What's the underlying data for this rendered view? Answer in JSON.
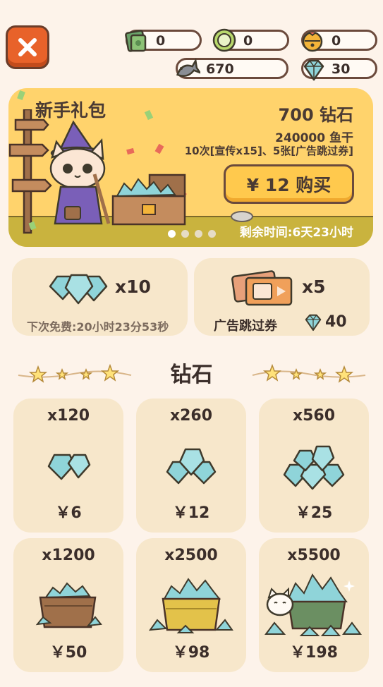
{
  "header": {
    "resources": [
      {
        "name": "cash",
        "value": "0"
      },
      {
        "name": "coin",
        "value": "0"
      },
      {
        "name": "bell",
        "value": "0"
      },
      {
        "name": "fish",
        "value": "670"
      },
      {
        "name": "diamond",
        "value": "30"
      }
    ]
  },
  "banner": {
    "title": "新手礼包",
    "diamond_amount": "700 钻石",
    "fish_amount": "240000 鱼干",
    "bonus": "10次[宣传x15]、5张[广告跳过券]",
    "buy_label": "¥ 12 购买",
    "remaining": "剩余时间:6天23小时",
    "page_count": 4,
    "active_page": 1
  },
  "packs": [
    {
      "count": "x10",
      "sub": "下次免费:20小时23分53秒"
    },
    {
      "count": "x5",
      "sub": "广告跳过券",
      "cost": "40"
    }
  ],
  "section": {
    "title": "钻石"
  },
  "diamond_shop": [
    {
      "amount": "x120",
      "price": "￥6"
    },
    {
      "amount": "x260",
      "price": "￥12"
    },
    {
      "amount": "x560",
      "price": "￥25"
    },
    {
      "amount": "x1200",
      "price": "￥50"
    },
    {
      "amount": "x2500",
      "price": "￥98"
    },
    {
      "amount": "x5500",
      "price": "￥198"
    }
  ],
  "colors": {
    "accent": "#e8622a",
    "banner": "#ffd36c",
    "card": "#f7e7cb",
    "gem": "#8fd4d9"
  }
}
